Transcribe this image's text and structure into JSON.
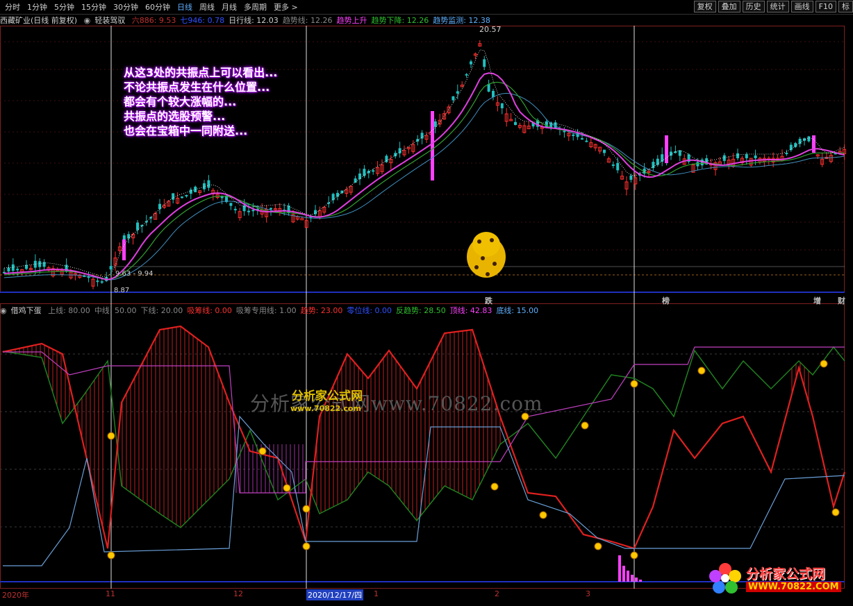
{
  "toolbar": {
    "periods": [
      "分时",
      "1分钟",
      "5分钟",
      "15分钟",
      "30分钟",
      "60分钟",
      "日线",
      "周线",
      "月线",
      "多周期",
      "更多 >"
    ],
    "active_period": "日线",
    "buttons": [
      "复权",
      "叠加",
      "历史",
      "统计",
      "画线",
      "F10",
      "标"
    ]
  },
  "main_panel": {
    "stock": "西藏矿业(日线 前复权)",
    "indicator": "轻装驾驭",
    "params": [
      {
        "label": "六886: 9.53",
        "color": "#c03030"
      },
      {
        "label": "七946: 0.78",
        "color": "#3050ff"
      },
      {
        "label": "日行线: 12.03",
        "color": "#d0d0d0"
      },
      {
        "label": "趋势线: 12.26",
        "color": "#888888"
      },
      {
        "label": "趋势上升",
        "color": "#ff40ff"
      },
      {
        "label": "趋势下降: 12.26",
        "color": "#30c030"
      },
      {
        "label": "趋势监测: 12.38",
        "color": "#5fb0ff"
      }
    ],
    "price_labels": {
      "high": "20.57",
      "mid": "9.63 - 9.94",
      "low": "8.87"
    }
  },
  "annotation": [
    "从这3处的共振点上可以看出...",
    "不论共振点发生在什么位置...",
    "都会有个较大涨幅的...",
    "共振点的选股预警...",
    "也会在宝箱中一同附送..."
  ],
  "signals": [
    {
      "text": "跌",
      "color": "#30ff30"
    },
    {
      "text": "榜",
      "color": "#ffd000"
    },
    {
      "text": "增",
      "color": "#ff5050"
    },
    {
      "text": "财",
      "color": "#5fb0ff"
    }
  ],
  "sub_panel": {
    "indicator": "借鸡下蛋",
    "params": [
      {
        "label": "上线: 80.00",
        "color": "#888888"
      },
      {
        "label": "中线: 50.00",
        "color": "#888888"
      },
      {
        "label": "下线: 20.00",
        "color": "#888888"
      },
      {
        "label": "吸筹线: 0.00",
        "color": "#ff3030"
      },
      {
        "label": "吸筹专用线: 1.00",
        "color": "#888888"
      },
      {
        "label": "趋势: 23.00",
        "color": "#ff3030"
      },
      {
        "label": "零位线: 0.00",
        "color": "#3050ff"
      },
      {
        "label": "反趋势: 28.50",
        "color": "#30c030"
      },
      {
        "label": "顶线: 42.83",
        "color": "#ff40ff"
      },
      {
        "label": "底线: 15.00",
        "color": "#5fb0ff"
      }
    ]
  },
  "watermark": {
    "site": "分析家公式网www.70822.com",
    "brand": "分析家公式网",
    "url": "www.70822.com"
  },
  "logo": {
    "title": "分析家公式网",
    "url": "WWW.70822.COM"
  },
  "dates": [
    "2020年",
    "11",
    "12",
    "2020/12/17/四",
    "1",
    "2",
    "3"
  ],
  "colors": {
    "up": "#ff3030",
    "down": "#20c0c0",
    "ma1": "#e040e0",
    "ma2": "#4090c0",
    "ma3": "#30a030"
  }
}
